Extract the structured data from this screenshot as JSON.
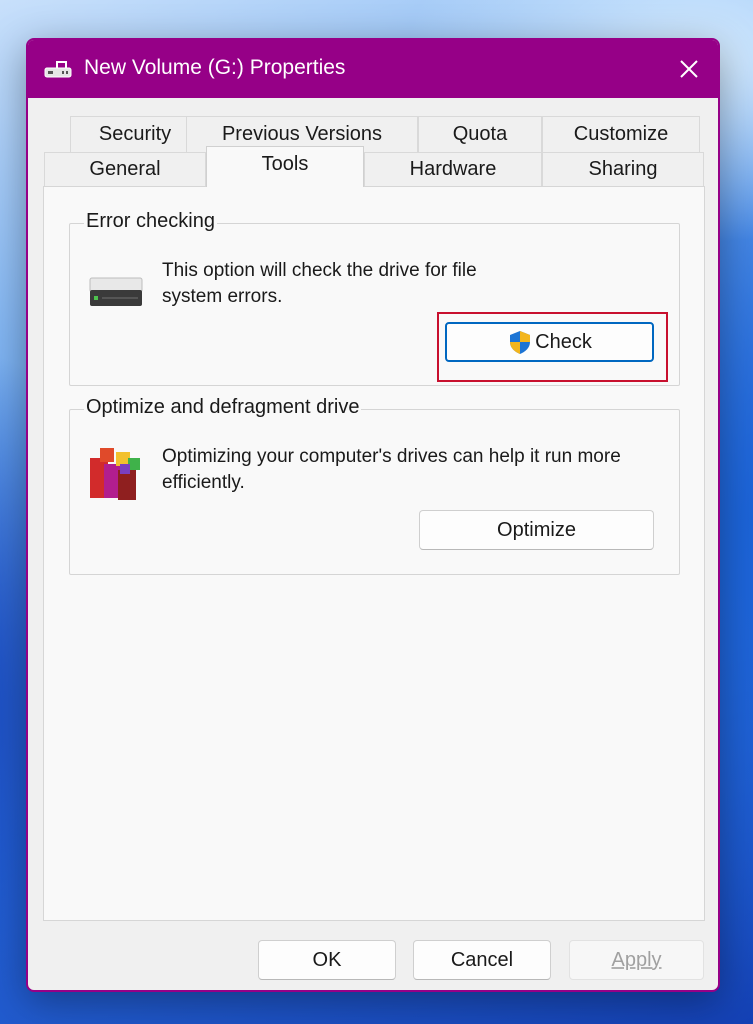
{
  "window": {
    "title": "New Volume (G:) Properties",
    "titlebar_color": "#960087",
    "drive_icon": "drive-icon",
    "close_icon": "close-icon"
  },
  "tabs": {
    "row_back": [
      "Security",
      "Previous Versions",
      "Quota",
      "Customize"
    ],
    "row_front": [
      "General",
      "Tools",
      "Hardware",
      "Sharing"
    ],
    "active": "Tools"
  },
  "error_checking": {
    "title": "Error checking",
    "description": "This option will check the drive for file system errors.",
    "button_label": "Check",
    "icon": "hard-drive-icon",
    "button_icon": "uac-shield-icon",
    "highlight_color": "#c8102e"
  },
  "optimize": {
    "title": "Optimize and defragment drive",
    "description": "Optimizing your computer's drives can help it run more efficiently.",
    "button_label": "Optimize",
    "icon": "defrag-icon"
  },
  "footer": {
    "ok_label": "OK",
    "cancel_label": "Cancel",
    "apply_label": "Apply"
  }
}
